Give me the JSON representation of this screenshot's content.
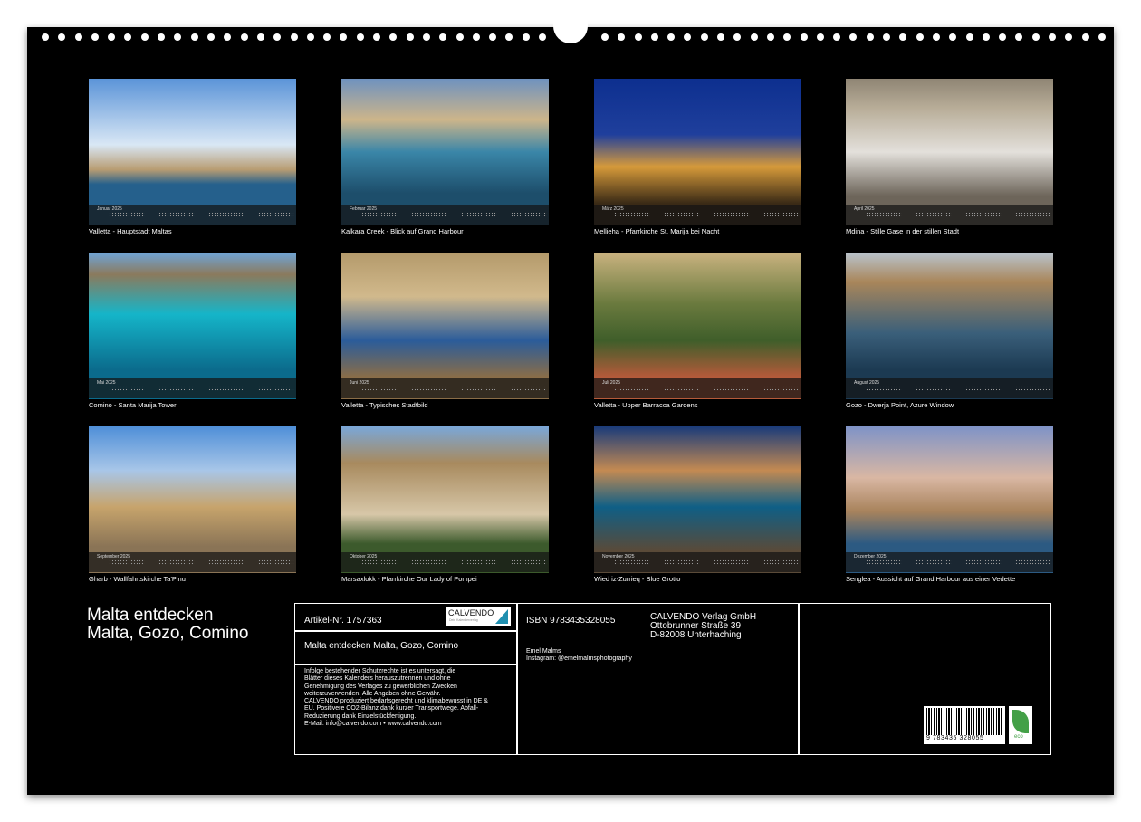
{
  "months": [
    {
      "label": "Januar 2025",
      "caption": "Valletta - Hauptstadt Maltas",
      "colors": [
        "#5b94d8",
        "#d9e7f5",
        "#b89c72",
        "#25608c"
      ],
      "bands": [
        0.45,
        0.62,
        0.72
      ]
    },
    {
      "label": "Februar 2025",
      "caption": "Kalkara Creek - Blick auf Grand Harbour",
      "colors": [
        "#6f92bf",
        "#cdb58a",
        "#3a86a8",
        "#1d4e6b"
      ],
      "bands": [
        0.28,
        0.5,
        0.78
      ]
    },
    {
      "label": "März 2025",
      "caption": "Mellieha - Pfarrkirche St. Marija bei Nacht",
      "colors": [
        "#0d2f8f",
        "#1f3f9c",
        "#d69a3a",
        "#3a2a16"
      ],
      "bands": [
        0.38,
        0.6,
        0.85
      ]
    },
    {
      "label": "April 2025",
      "caption": "Mdina - Stille Gase in der stillen Stadt",
      "colors": [
        "#8f8574",
        "#b8ad98",
        "#e3e0db",
        "#6d655a"
      ],
      "bands": [
        0.2,
        0.5,
        0.8
      ]
    },
    {
      "label": "Mai 2025",
      "caption": "Comino - Santa Marija Tower",
      "colors": [
        "#6fa4d6",
        "#8b7a5d",
        "#15b5c9",
        "#0b6b8c"
      ],
      "bands": [
        0.15,
        0.42,
        0.8
      ]
    },
    {
      "label": "Juni 2025",
      "caption": "Valletta - Typisches Stadtbild",
      "colors": [
        "#b49a6b",
        "#d1b98c",
        "#2b5c9a",
        "#8a6d47"
      ],
      "bands": [
        0.3,
        0.6,
        0.85
      ]
    },
    {
      "label": "Juli 2025",
      "caption": "Valletta - Upper Barracca Gardens",
      "colors": [
        "#c9b27f",
        "#6a7a3e",
        "#3f5e2a",
        "#b55a3a"
      ],
      "bands": [
        0.35,
        0.6,
        0.85
      ]
    },
    {
      "label": "August 2025",
      "caption": "Gozo - Dwerja Point, Azure Window",
      "colors": [
        "#b9c3cc",
        "#a9865a",
        "#3a5f7a",
        "#1c3a52"
      ],
      "bands": [
        0.2,
        0.55,
        0.8
      ]
    },
    {
      "label": "September 2025",
      "caption": "Gharb - Wallfahrtskirche Ta'Pinu",
      "colors": [
        "#4f8fd8",
        "#a8c6e8",
        "#c7a46c",
        "#8a7456"
      ],
      "bands": [
        0.3,
        0.55,
        0.82
      ]
    },
    {
      "label": "Oktober 2025",
      "caption": "Marsaxlokk - Pfarrkirche Our Lady of Pompei",
      "colors": [
        "#7aa7d8",
        "#a88a5e",
        "#d7c7a8",
        "#3c5a2c"
      ],
      "bands": [
        0.25,
        0.6,
        0.8
      ]
    },
    {
      "label": "November 2025",
      "caption": "Wied iz-Zurrieq - Blue Grotto",
      "colors": [
        "#1a3b7a",
        "#c48a52",
        "#0f5f86",
        "#5a4a38"
      ],
      "bands": [
        0.3,
        0.55,
        0.85
      ]
    },
    {
      "label": "Dezember 2025",
      "caption": "Senglea - Aussicht auf Grand Harbour aus einer Vedette",
      "colors": [
        "#7f93c7",
        "#d9b7a3",
        "#a8835c",
        "#2c5a82"
      ],
      "bands": [
        0.35,
        0.58,
        0.8
      ]
    }
  ],
  "title": {
    "line1": "Malta entdecken",
    "line2": "Malta, Gozo, Comino"
  },
  "info": {
    "article": "Artikel-Nr. 1757363",
    "logo_text": "CALVENDO",
    "logo_sub": "Dein Kalenderverlag",
    "subtitle": "Malta entdecken Malta, Gozo, Comino",
    "legal": [
      "Infolge bestehender Schutzrechte ist es untersagt, die",
      "Blätter dieses Kalenders herauszutrennen und ohne",
      "Genehmigung des Verlages zu gewerblichen Zwecken",
      "weiterzuverwenden. Alle Angaben ohne Gewähr.",
      "CALVENDO produziert bedarfsgerecht und klimabewusst in DE &",
      "EU. Positivere CO2-Bilanz dank kurzer Transportwege. Abfall-",
      "Reduzierung dank Einzelstückfertigung.",
      "E-Mail: info@calvendo.com • www.calvendo.com"
    ],
    "isbn": "ISBN 9783435328055",
    "publisher": [
      "CALVENDO Verlag GmbH",
      "Ottobrunner Straße 39",
      "D-82008 Unterhaching"
    ],
    "author": "Emel Malms",
    "instagram": "Instagram: @emelmalmsphotography",
    "barcode_number": "9 783435 328055",
    "eco_label": "eco"
  }
}
